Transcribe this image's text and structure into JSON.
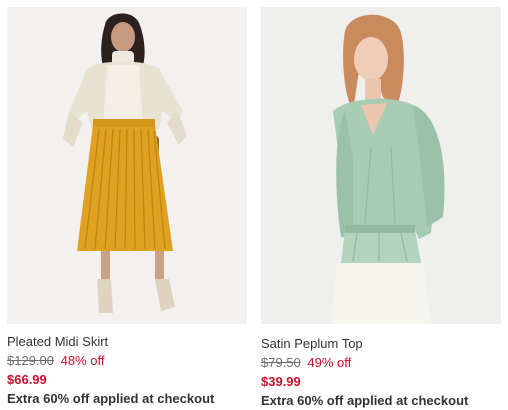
{
  "products": [
    {
      "name": "Pleated Midi Skirt",
      "original_price": "$129.00",
      "discount": "48% off",
      "sale_price": "$66.99",
      "promo": "Extra 60% off applied at checkout",
      "image_icon": "product-photo-skirt"
    },
    {
      "name": "Satin Peplum Top",
      "original_price": "$79.50",
      "discount": "49% off",
      "sale_price": "$39.99",
      "promo": "Extra 60% off applied at checkout",
      "image_icon": "product-photo-top"
    }
  ],
  "colors": {
    "sale_red": "#c8102e",
    "text_dark": "#333333",
    "text_muted": "#6d6d6d",
    "skirt_mustard": "#e0a020",
    "top_sage": "#a8cbb4"
  }
}
